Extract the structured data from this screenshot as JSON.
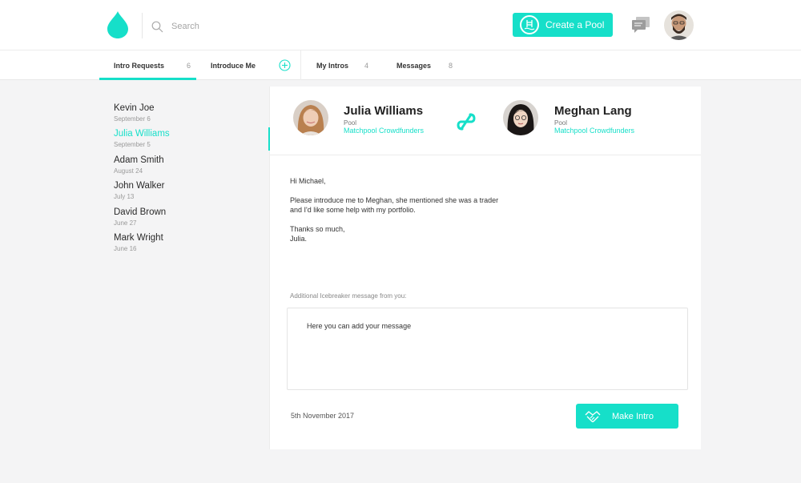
{
  "colors": {
    "accent": "#16dfc9",
    "text": "#2b2b2b",
    "muted": "#999999",
    "background": "#f4f4f5"
  },
  "header": {
    "search_placeholder": "Search",
    "create_button": "Create a Pool",
    "icons": [
      "drop-logo-icon",
      "search-icon",
      "pool-icon",
      "chat-icon",
      "user-avatar"
    ]
  },
  "tabs": [
    {
      "label": "Intro Requests",
      "count": "6"
    },
    {
      "label": "Introduce Me",
      "count": ""
    },
    {
      "label": "My Intros",
      "count": "4"
    },
    {
      "label": "Messages",
      "count": "8"
    }
  ],
  "requests": [
    {
      "name": "Kevin Joe",
      "date": "September 6"
    },
    {
      "name": "Julia Williams",
      "date": "September 5"
    },
    {
      "name": "Adam Smith",
      "date": "August 24"
    },
    {
      "name": "John Walker",
      "date": "July 13"
    },
    {
      "name": "David Brown",
      "date": "June 27"
    },
    {
      "name": "Mark Wright",
      "date": "June 16"
    }
  ],
  "intro": {
    "person_a": {
      "name": "Julia Williams",
      "role": "Pool",
      "pool": "Matchpool Crowdfunders"
    },
    "person_b": {
      "name": "Meghan Lang",
      "role": "Pool",
      "pool": "Matchpool Crowdfunders"
    },
    "message": {
      "greeting": "Hi Michael,",
      "line1": "Please introduce me to Meghan, she mentioned she was a trader",
      "line2": "and I'd like some help with my portfolio.",
      "closing": "Thanks so much,",
      "signature": "Julia."
    },
    "icebreaker_label": "Additional Icebreaker message from you:",
    "icebreaker_placeholder": "Here you can add your message",
    "date": "5th November 2017",
    "make_intro_button": "Make Intro"
  }
}
